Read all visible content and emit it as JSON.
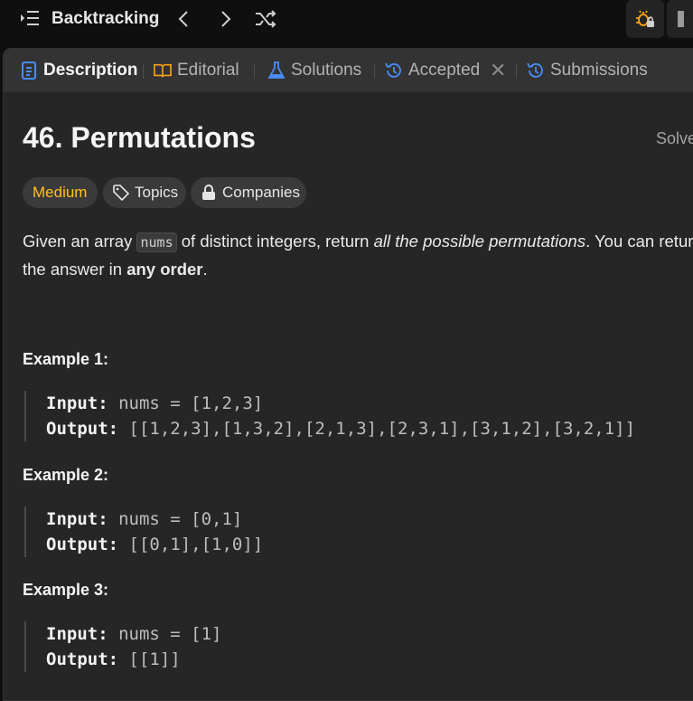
{
  "topbar": {
    "problem_list_title": "Backtracking",
    "icons": [
      "list-icon",
      "prev-icon",
      "next-icon",
      "shuffle-icon",
      "debug-locked-icon"
    ]
  },
  "tabs": [
    {
      "label": "Description",
      "icon": "description-icon",
      "active": true
    },
    {
      "label": "Editorial",
      "icon": "book-icon"
    },
    {
      "label": "Solutions",
      "icon": "flask-icon"
    },
    {
      "label": "Accepted",
      "icon": "history-icon",
      "closable": true
    },
    {
      "label": "Submissions",
      "icon": "history-icon"
    }
  ],
  "problem": {
    "title": "46. Permutations",
    "solved_label": "Solved",
    "difficulty": "Medium",
    "topics_label": "Topics",
    "companies_label": "Companies",
    "description": {
      "part1": "Given an array ",
      "code": "nums",
      "part2": " of distinct integers, return ",
      "emph": "all the possible permutations",
      "part3": ". You can return",
      "line2_part1": "the answer in ",
      "line2_bold": "any order",
      "line2_part2": "."
    },
    "examples": [
      {
        "heading": "Example 1:",
        "input_label": "Input:",
        "input": "nums = [1,2,3]",
        "output_label": "Output:",
        "output": "[[1,2,3],[1,3,2],[2,1,3],[2,3,1],[3,1,2],[3,2,1]]"
      },
      {
        "heading": "Example 2:",
        "input_label": "Input:",
        "input": "nums = [0,1]",
        "output_label": "Output:",
        "output": "[[0,1],[1,0]]"
      },
      {
        "heading": "Example 3:",
        "input_label": "Input:",
        "input": "nums = [1]",
        "output_label": "Output:",
        "output": "[[1]]"
      }
    ]
  },
  "colors": {
    "background": "#0f0f0f",
    "panel": "#262626",
    "tabbar": "#333333",
    "medium": "#ffc01e",
    "active_tab_icon": "#4a8cf7",
    "editorial_icon": "#ffa116"
  }
}
